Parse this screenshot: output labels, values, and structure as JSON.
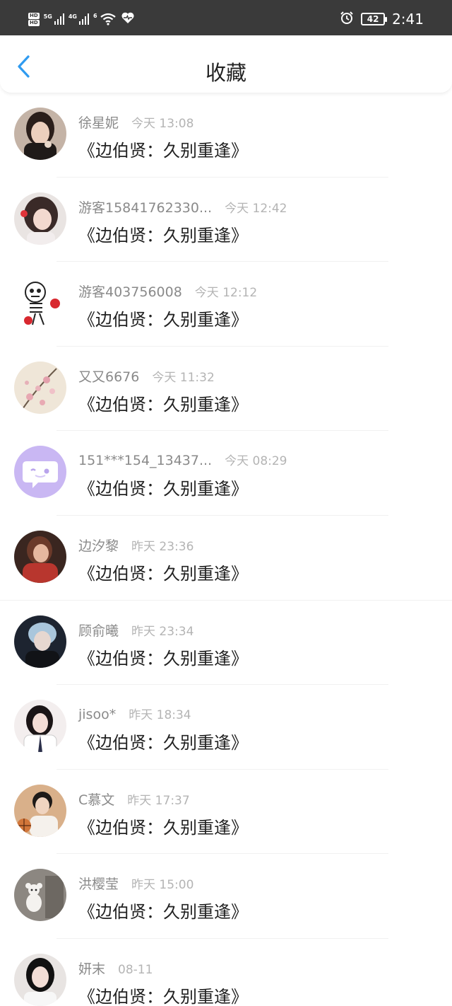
{
  "status_bar": {
    "hd1": "HD",
    "hd2": "HD",
    "net1": "5G",
    "net2": "4G",
    "wifi_label": "6",
    "battery": "42",
    "time": "2:41"
  },
  "header": {
    "title": "收藏",
    "back_icon": "chevron-left-icon",
    "accent_color": "#2f9bf0"
  },
  "favorites": [
    {
      "name": "徐星妮",
      "time": "今天 13:08",
      "subject": "《边伯贤：久别重逢》",
      "avatar": "photo-woman-dark"
    },
    {
      "name": "游客15841762330...",
      "time": "今天 12:42",
      "subject": "《边伯贤：久别重逢》",
      "avatar": "photo-woman-heart"
    },
    {
      "name": "游客403756008",
      "time": "今天 12:12",
      "subject": "《边伯贤：久别重逢》",
      "avatar": "skeleton-boxer-drawing"
    },
    {
      "name": "又又6676",
      "time": "今天 11:32",
      "subject": "《边伯贤：久别重逢》",
      "avatar": "plum-blossom-painting"
    },
    {
      "name": "151***154_13437...",
      "time": "今天 08:29",
      "subject": "《边伯贤：久别重逢》",
      "avatar": "default-chat-bubble"
    },
    {
      "name": "边汐黎",
      "time": "昨天 23:36",
      "subject": "《边伯贤：久别重逢》",
      "avatar": "photo-woman-red"
    },
    {
      "name": "顾俞曦",
      "time": "昨天 23:34",
      "subject": "《边伯贤：久别重逢》",
      "avatar": "photo-man-blue-hair"
    },
    {
      "name": "jisoo*",
      "time": "昨天 18:34",
      "subject": "《边伯贤：久别重逢》",
      "avatar": "photo-woman-tie"
    },
    {
      "name": "C慕文",
      "time": "昨天 17:37",
      "subject": "《边伯贤：久别重逢》",
      "avatar": "photo-man-basketball"
    },
    {
      "name": "洪樱莹",
      "time": "昨天 15:00",
      "subject": "《边伯贤：久别重逢》",
      "avatar": "photo-teddy-bear"
    },
    {
      "name": "妍末",
      "time": "08-11",
      "subject": "《边伯贤：久别重逢》",
      "avatar": "photo-woman-black-hair"
    }
  ]
}
